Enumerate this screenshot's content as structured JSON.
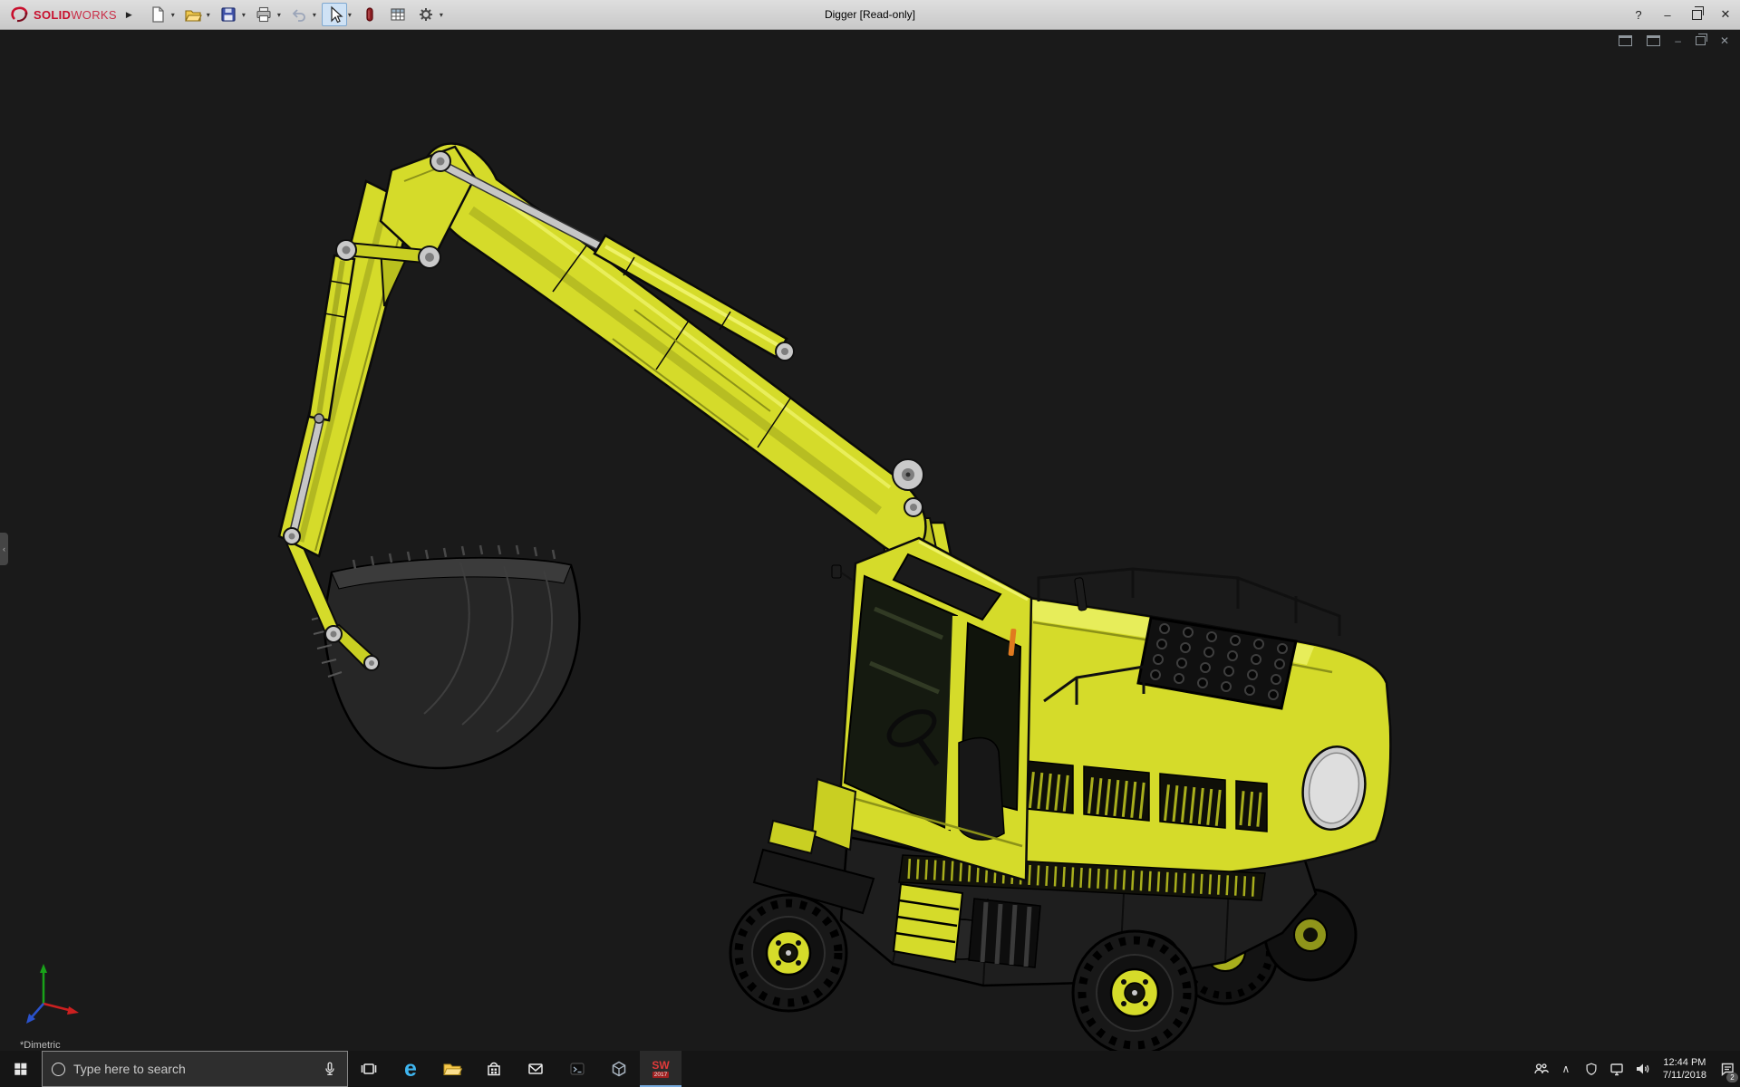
{
  "colors": {
    "excavator_yellow": "#d5db2a",
    "viewport_background": "#1a1a1a",
    "titlebar_background": "#d4d4d4",
    "taskbar_background": "#151515",
    "logo_red": "#c8102e",
    "active_tool_highlight": "#cfe2f5"
  },
  "title_bar": {
    "logo_solid": "SOLID",
    "logo_works": "WORKS",
    "expand_arrow": "▶",
    "caret": "▾",
    "title": "Digger [Read-only]",
    "help": "?",
    "minimize": "–",
    "close": "✕",
    "tools": [
      {
        "name": "new-document"
      },
      {
        "name": "open"
      },
      {
        "name": "save"
      },
      {
        "name": "print"
      },
      {
        "name": "undo"
      },
      {
        "name": "select-cursor",
        "active": true
      },
      {
        "name": "rebuild"
      },
      {
        "name": "design-table"
      },
      {
        "name": "options"
      }
    ]
  },
  "viewport": {
    "orientation_label": "*Dimetric",
    "panel_flyout_arrow": "‹",
    "doc_window_controls": {
      "minimize": "–",
      "close": "✕"
    },
    "model": "yellow wheeled excavator 3D model, dimetric view"
  },
  "taskbar": {
    "search_placeholder": "Type here to search",
    "edge_glyph": "e",
    "sw_mark": "SW",
    "sw_year": "2017",
    "apps": [
      {
        "name": "task-view"
      },
      {
        "name": "edge"
      },
      {
        "name": "file-explorer"
      },
      {
        "name": "store"
      },
      {
        "name": "mail"
      },
      {
        "name": "terminal"
      },
      {
        "name": "cad-cube"
      },
      {
        "name": "solidworks-2017",
        "active": true
      }
    ],
    "tray": {
      "chevron": "∧",
      "time": "12:44 PM",
      "date": "7/11/2018",
      "notification_badge": "2"
    }
  }
}
